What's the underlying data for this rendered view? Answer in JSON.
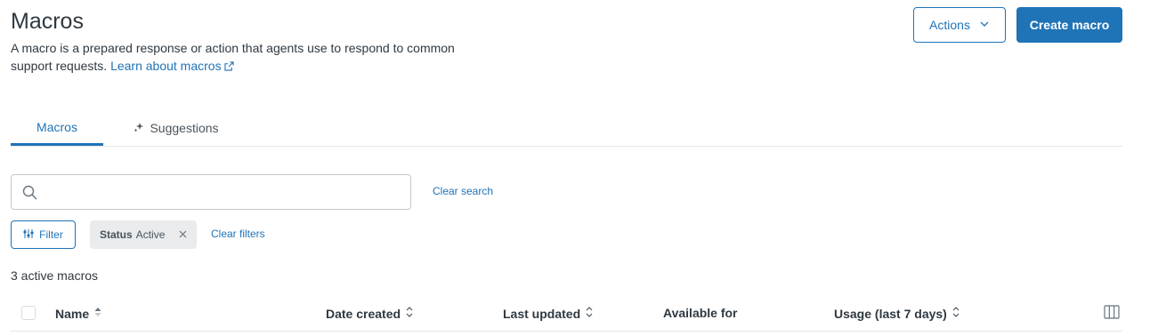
{
  "header": {
    "title": "Macros",
    "description": "A macro is a prepared response or action that agents use to respond to common support requests.",
    "learn_link": "Learn about macros",
    "actions_label": "Actions",
    "create_label": "Create macro"
  },
  "tabs": [
    {
      "label": "Macros",
      "selected": true
    },
    {
      "label": "Suggestions",
      "selected": false
    }
  ],
  "search": {
    "value": "",
    "placeholder": "",
    "clear_label": "Clear search"
  },
  "filters": {
    "filter_label": "Filter",
    "chips": [
      {
        "key": "Status",
        "value": "Active"
      }
    ],
    "clear_label": "Clear filters"
  },
  "count_text": "3 active macros",
  "table": {
    "columns": [
      "Name",
      "Date created",
      "Last updated",
      "Available for",
      "Usage (last 7 days)"
    ]
  },
  "colors": {
    "accent": "#1f73b7",
    "text": "#2f3941",
    "border": "#e2e5e8",
    "chip_bg": "#e9ebed"
  }
}
